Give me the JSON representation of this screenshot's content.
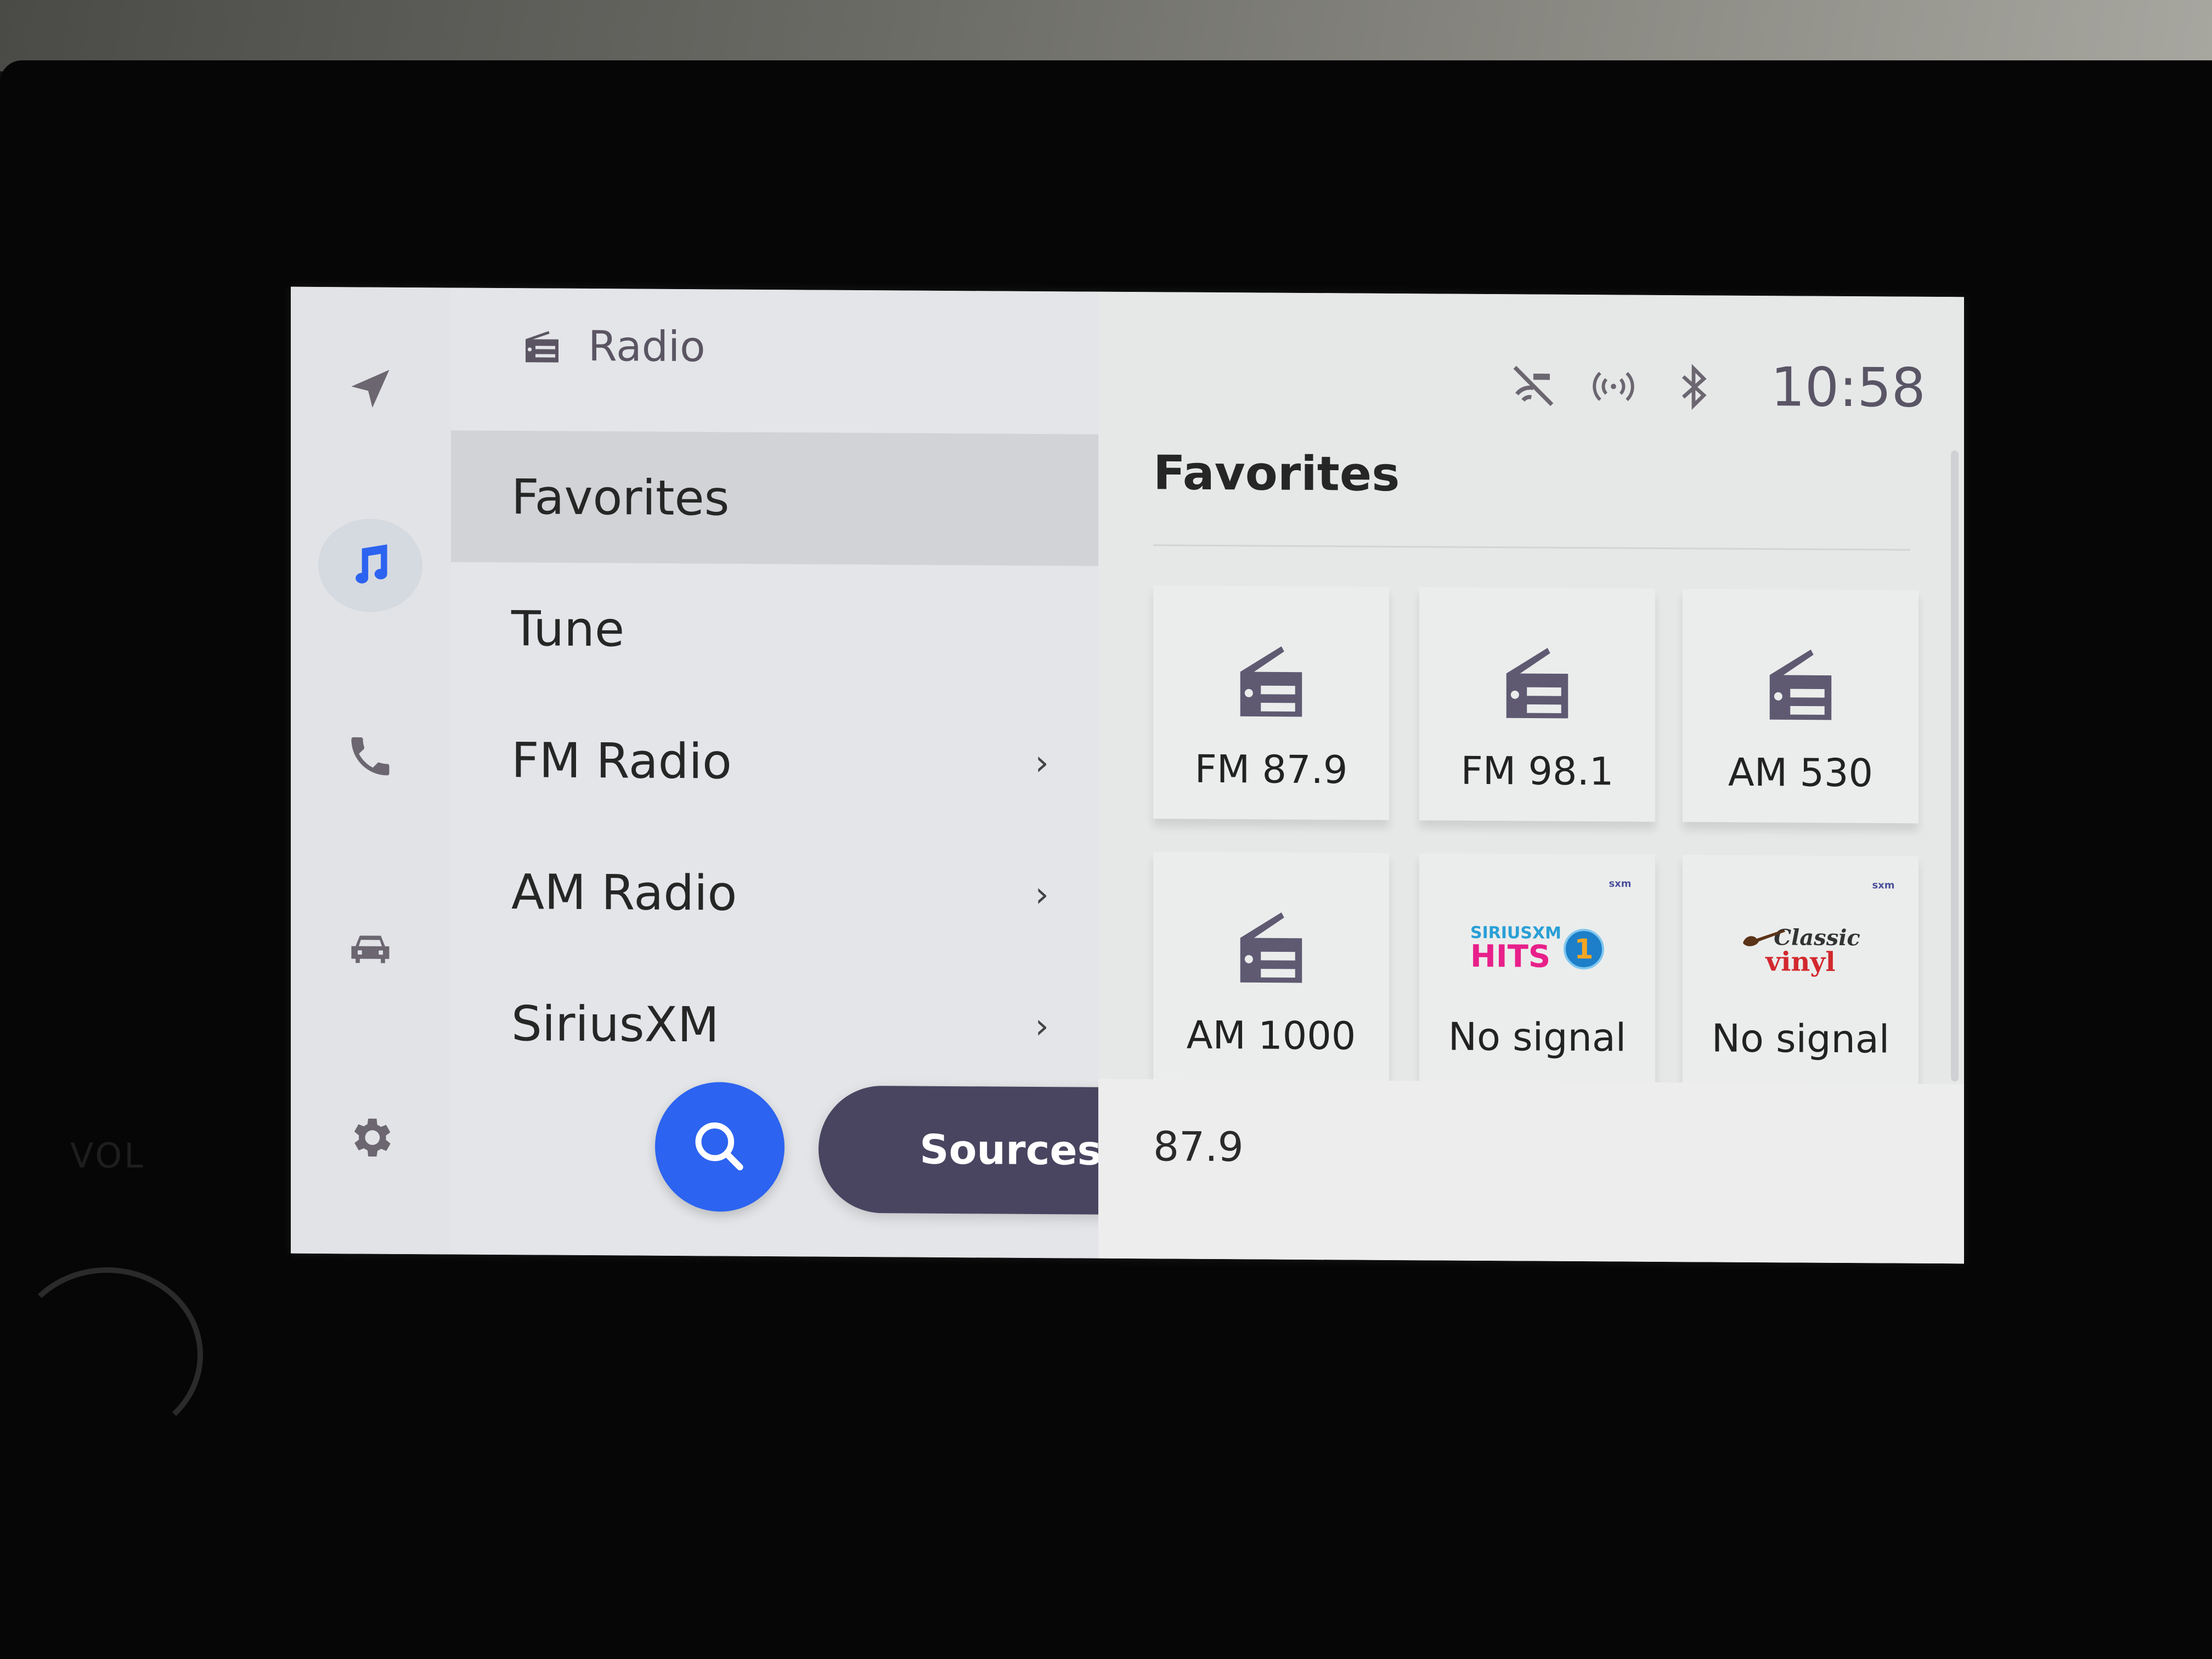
{
  "bezel": {
    "volume_label": "VOL"
  },
  "rail": {
    "items": [
      {
        "name": "navigation",
        "icon": "navigation-arrow-icon",
        "active": false
      },
      {
        "name": "media",
        "icon": "music-note-icon",
        "active": true
      },
      {
        "name": "phone",
        "icon": "phone-icon",
        "active": false
      },
      {
        "name": "vehicle",
        "icon": "car-icon",
        "active": false
      },
      {
        "name": "settings",
        "icon": "gear-icon",
        "active": false
      }
    ],
    "accent_color": "#2c63f0"
  },
  "menu": {
    "header": {
      "icon": "radio-icon",
      "title": "Radio"
    },
    "items": [
      {
        "label": "Favorites",
        "selected": true,
        "has_submenu": false
      },
      {
        "label": "Tune",
        "selected": false,
        "has_submenu": false
      },
      {
        "label": "FM Radio",
        "selected": false,
        "has_submenu": true
      },
      {
        "label": "AM Radio",
        "selected": false,
        "has_submenu": true
      },
      {
        "label": "SiriusXM",
        "selected": false,
        "has_submenu": true
      }
    ],
    "chevron": "›",
    "search_button": {
      "icon": "search-icon"
    },
    "sources_button": {
      "label": "Sources"
    }
  },
  "status_bar": {
    "icons": [
      "no-wifi-icon",
      "broadcast-signal-icon",
      "bluetooth-icon"
    ],
    "time": "10:58"
  },
  "favorites": {
    "title": "Favorites",
    "tiles": [
      {
        "label": "FM 87.9",
        "type": "radio"
      },
      {
        "label": "FM 98.1",
        "type": "radio"
      },
      {
        "label": "AM 530",
        "type": "radio"
      },
      {
        "label": "AM 1000",
        "type": "radio"
      },
      {
        "label": "No signal",
        "type": "siriusxm",
        "logo_line1": "SIRIUSXM",
        "logo_line2": "HITS",
        "logo_badge": "1",
        "sxm_badge": "sxm"
      },
      {
        "label": "No signal",
        "type": "siriusxm",
        "logo_line1": "Classic",
        "logo_line2": "vinyl",
        "sxm_badge": "sxm"
      }
    ]
  },
  "now_playing": {
    "frequency": "87.9"
  }
}
